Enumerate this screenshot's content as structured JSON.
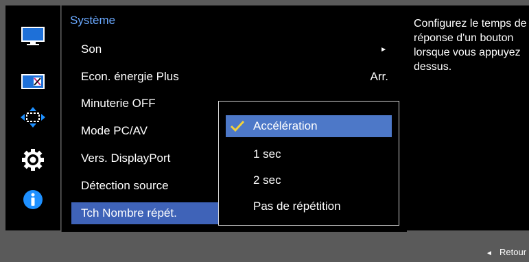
{
  "menu": {
    "title": "Système",
    "items": [
      {
        "label": "Son",
        "value": "►"
      },
      {
        "label": "Econ. énergie Plus",
        "value": "Arr."
      },
      {
        "label": "Minuterie OFF",
        "value": ""
      },
      {
        "label": "Mode PC/AV",
        "value": ""
      },
      {
        "label": "Vers. DisplayPort",
        "value": ""
      },
      {
        "label": "Détection source",
        "value": ""
      },
      {
        "label": "Tch Nombre répét.",
        "value": ""
      }
    ],
    "selected_index": 6
  },
  "popup": {
    "options": [
      "Accélération",
      "1 sec",
      "2 sec",
      "Pas de répétition"
    ],
    "selected_index": 0
  },
  "help": {
    "text": "Configurez le temps de réponse d'un bouton lorsque vous appuyez dessus."
  },
  "footer": {
    "back_label": "Retour",
    "back_arrow": "◄"
  },
  "icons": [
    "picture-icon",
    "color-icon",
    "screen-size-icon",
    "settings-gear-icon",
    "info-icon"
  ],
  "colors": {
    "accent_blue": "#4d78c8",
    "title_blue": "#6aa9ff",
    "check_yellow": "#f2d23a"
  }
}
